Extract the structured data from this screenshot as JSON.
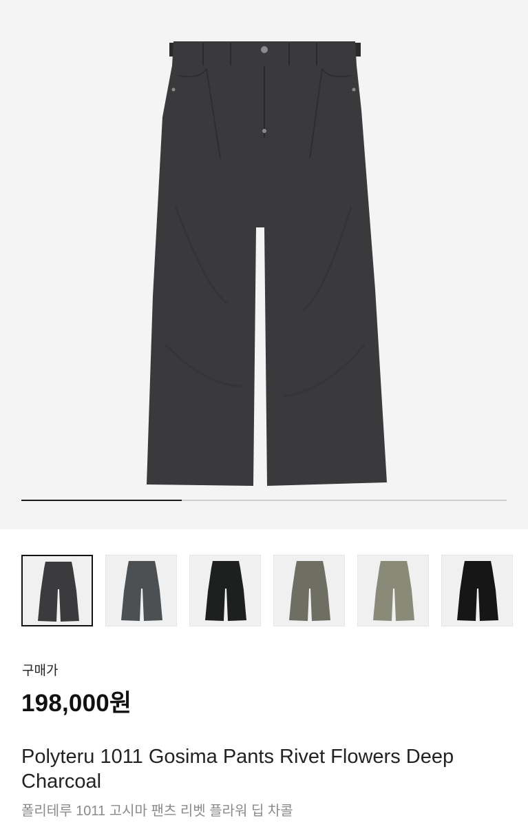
{
  "hero": {
    "image_icon": "pants-photo",
    "pants_color": "#3a3a3c",
    "carousel_progress": 0.33
  },
  "thumbnails": [
    {
      "icon": "pants-thumb-deep-charcoal",
      "color": "#3b3b3e",
      "selected": true
    },
    {
      "icon": "pants-thumb-grey",
      "color": "#4c5052",
      "selected": false
    },
    {
      "icon": "pants-thumb-black-washed",
      "color": "#1e2020",
      "selected": false
    },
    {
      "icon": "pants-thumb-olive-grey",
      "color": "#6e6e62",
      "selected": false
    },
    {
      "icon": "pants-thumb-khaki",
      "color": "#8a8a78",
      "selected": false
    },
    {
      "icon": "pants-thumb-black",
      "color": "#161616",
      "selected": false
    }
  ],
  "price": {
    "label": "구매가",
    "value": "198,000원"
  },
  "product": {
    "title_en": "Polyteru 1011 Gosima Pants Rivet Flowers Deep Charcoal",
    "title_ko": "폴리테루 1011 고시마 팬츠 리벳 플라워 딥 차콜"
  }
}
